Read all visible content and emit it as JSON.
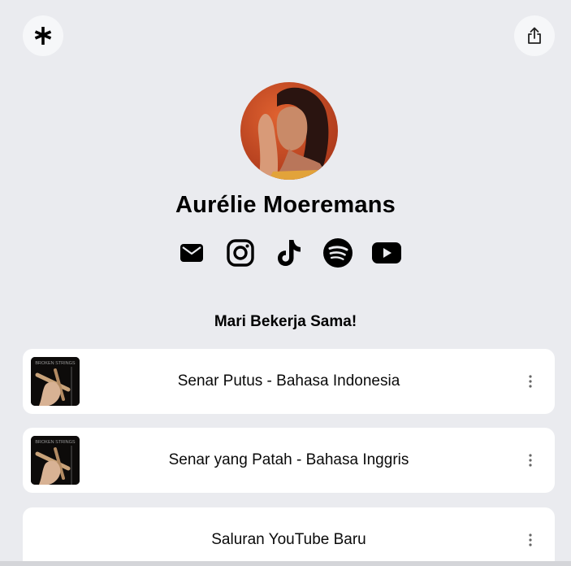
{
  "header": {
    "logo_icon": "linktree-asterisk-icon",
    "share_icon": "share-icon"
  },
  "profile": {
    "name": "Aurélie Moeremans",
    "avatar_bg": "#c8481e"
  },
  "socials": [
    {
      "icon": "email-icon"
    },
    {
      "icon": "instagram-icon"
    },
    {
      "icon": "tiktok-icon"
    },
    {
      "icon": "spotify-icon"
    },
    {
      "icon": "youtube-icon"
    }
  ],
  "section": {
    "title": "Mari Bekerja Sama!"
  },
  "links": [
    {
      "label": "Senar Putus - Bahasa Indonesia",
      "thumb_text": "BROKEN STRINGS"
    },
    {
      "label": "Senar yang Patah - Bahasa Inggris",
      "thumb_text": "BROKEN STRINGS"
    },
    {
      "label": "Saluran YouTube Baru"
    }
  ],
  "colors": {
    "background": "#eaebef",
    "card": "#ffffff",
    "text": "#000000"
  }
}
